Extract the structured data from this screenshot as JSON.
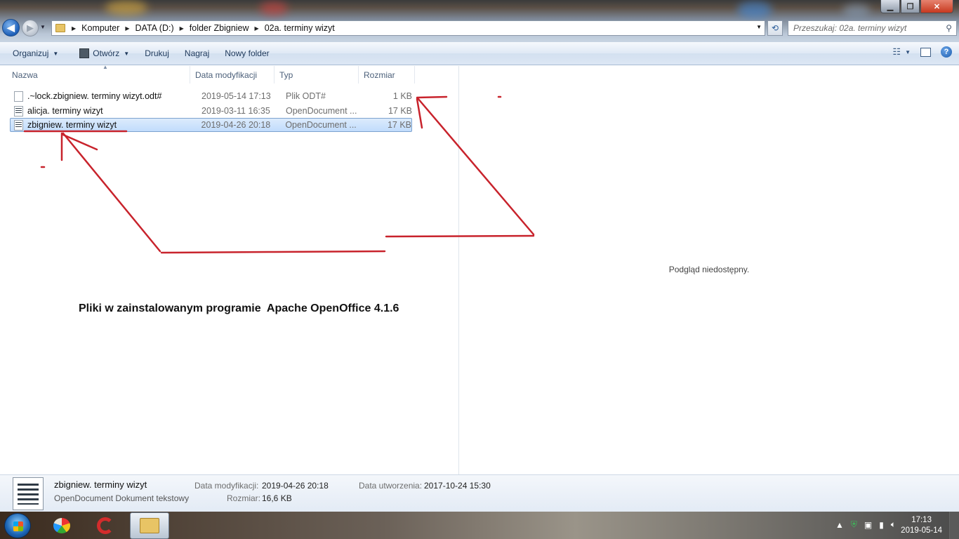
{
  "window": {
    "controls": {
      "minimize": "▁",
      "maximize": "❐",
      "close": "✕"
    }
  },
  "address": {
    "crumbs": [
      "Komputer",
      "DATA (D:)",
      "folder Zbigniew",
      "02a. terminy wizyt"
    ]
  },
  "search": {
    "placeholder": "Przeszukaj: 02a. terminy wizyt"
  },
  "toolbar": {
    "organize": "Organizuj",
    "open": "Otwórz",
    "print": "Drukuj",
    "burn": "Nagraj",
    "new_folder": "Nowy folder"
  },
  "columns": {
    "name": "Nazwa",
    "date": "Data modyfikacji",
    "type": "Typ",
    "size": "Rozmiar"
  },
  "files": [
    {
      "name": ".~lock.zbigniew. terminy wizyt.odt#",
      "date": "2019-05-14 17:13",
      "type": "Plik ODT#",
      "size": "1 KB",
      "icon": "blank-file-icon"
    },
    {
      "name": "alicja. terminy wizyt",
      "date": "2019-03-11 16:35",
      "type": "OpenDocument ...",
      "size": "17 KB",
      "icon": "odt-file-icon"
    },
    {
      "name": "zbigniew. terminy wizyt",
      "date": "2019-04-26 20:18",
      "type": "OpenDocument ...",
      "size": "17 KB",
      "icon": "odt-file-icon",
      "selected": true
    }
  ],
  "preview": {
    "text": "Podgląd niedostępny."
  },
  "annotation": {
    "caption": "Pliki w zainstalowanym programie  Apache OpenOffice 4.1.6",
    "color": "#c8232c"
  },
  "details": {
    "name": "zbigniew. terminy wizyt",
    "type": "OpenDocument Dokument tekstowy",
    "modified_label": "Data modyfikacji:",
    "modified_value": "2019-04-26 20:18",
    "size_label": "Rozmiar:",
    "size_value": "16,6 KB",
    "created_label": "Data utworzenia:",
    "created_value": "2017-10-24 15:30"
  },
  "taskbar": {
    "apps": [
      "paint-icon",
      "ccleaner-icon",
      "explorer-icon"
    ],
    "clock_time": "17:13",
    "clock_date": "2019-05-14"
  }
}
